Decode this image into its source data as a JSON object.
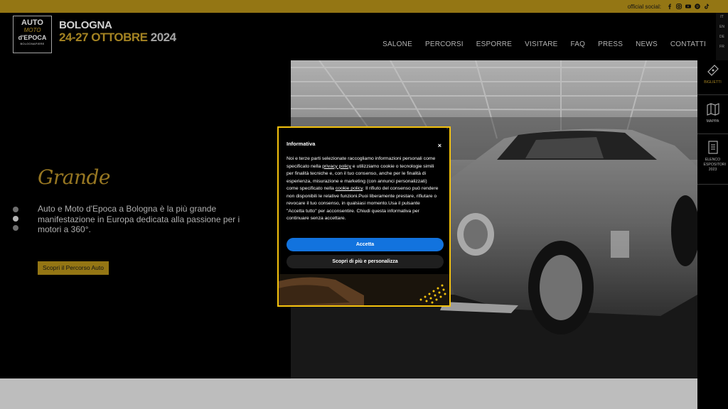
{
  "topbar": {
    "social_label": "official social:",
    "icons": [
      "facebook-icon",
      "instagram-icon",
      "youtube-icon",
      "spotify-icon",
      "tiktok-icon"
    ]
  },
  "header": {
    "logo": {
      "line1": "AUTO",
      "line2": "MOTO",
      "line3": "d'EPOCA",
      "line4": "BOLOGNAFIERE"
    },
    "city": "BOLOGNA",
    "dates": "24-27 OTTOBRE",
    "year": "2024"
  },
  "nav": {
    "items": [
      "SALONE",
      "PERCORSI",
      "ESPORRE",
      "VISITARE",
      "FAQ",
      "PRESS",
      "NEWS",
      "CONTATTI"
    ]
  },
  "languages": [
    "IT",
    "EN",
    "DE",
    "FR"
  ],
  "hero": {
    "title": "Grande",
    "text": "Auto e Moto d'Epoca a Bologna è la più grande manifestazione in Europa dedicata alla passione per i motori a 360°.",
    "button": "Scopri il Percorso Auto",
    "slides": 3,
    "active_slide": 2
  },
  "side_panel": {
    "items": [
      {
        "label": "BIGLIETTI",
        "icon": "ticket-icon"
      },
      {
        "label": "MAPPA",
        "icon": "map-icon"
      },
      {
        "label": "ELENCO ESPOSITORI 2023",
        "icon": "document-list-icon"
      }
    ]
  },
  "modal": {
    "title": "Informativa",
    "close": "×",
    "body_1": "Noi e terze parti selezionate raccogliamo informazioni personali come specificato nella ",
    "privacy_link": "privacy policy",
    "body_2": " e utilizziamo cookie o tecnologie simili per finalità tecniche e, con il tuo consenso, anche per le finalità di esperienza, misurazione e marketing (con annunci personalizzati) come specificato nella ",
    "cookie_link": "cookie policy",
    "body_3": ". Il rifiuto del consenso può rendere non disponibili le relative funzioni.Puoi liberamente prestare, rifiutare o revocare il tuo consenso, in qualsiasi momento.Usa il pulsante \"Accetta tutto\" per acconsentire. Chiudi questa informativa per continuare senza accettare.",
    "accept": "Accetta",
    "more": "Scopri di più e personalizza"
  },
  "colors": {
    "gold": "#b59019",
    "modal_border": "#f4c20d",
    "accept_blue": "#1273de"
  }
}
